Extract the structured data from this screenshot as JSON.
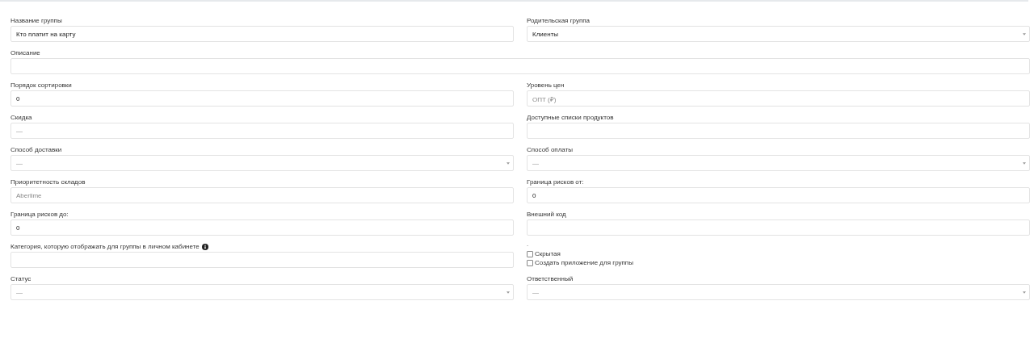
{
  "rows": [
    {
      "cells": [
        {
          "kind": "input",
          "label": "Название группы",
          "value": "Кто платит на карту"
        },
        {
          "kind": "select",
          "label": "Родительская группа",
          "value": "Клиенты"
        }
      ]
    },
    {
      "cells": [
        {
          "kind": "input",
          "label": "Описание"
        }
      ]
    },
    {
      "cells": [
        {
          "kind": "input",
          "label": "Порядок сортировки",
          "value": "0"
        },
        {
          "kind": "input",
          "label": "Уровень цен",
          "placeholder": "ОПТ (₽)"
        }
      ]
    },
    {
      "cells": [
        {
          "kind": "input",
          "label": "Скидка",
          "placeholder": "—"
        },
        {
          "kind": "input",
          "label": "Доступные списки продуктов"
        }
      ]
    },
    {
      "cells": [
        {
          "kind": "select",
          "label": "Способ доставки",
          "placeholder": "—"
        },
        {
          "kind": "select",
          "label": "Способ оплаты",
          "placeholder": "—"
        }
      ]
    },
    {
      "cells": [
        {
          "kind": "input",
          "label": "Приоритетность складов",
          "placeholder": "Aberlime"
        },
        {
          "kind": "input",
          "label": "Граница рисков от:",
          "value": "0"
        }
      ]
    },
    {
      "cells": [
        {
          "kind": "input",
          "label": "Граница рисков до:",
          "value": "0"
        },
        {
          "kind": "input",
          "label": "Внешний код"
        }
      ]
    },
    {
      "cells": [
        {
          "kind": "input",
          "label": "Категория, которую отображать для группы в личном кабинете",
          "info": true
        },
        {
          "kind": "checkboxes",
          "label": "-",
          "options": [
            {
              "label": "Скрытая",
              "checked": false
            },
            {
              "label": "Создать приложение для группы",
              "checked": false
            }
          ]
        }
      ]
    },
    {
      "cells": [
        {
          "kind": "select",
          "label": "Статус",
          "placeholder": "—"
        },
        {
          "kind": "select",
          "label": "Ответственный",
          "placeholder": "—"
        }
      ]
    }
  ]
}
